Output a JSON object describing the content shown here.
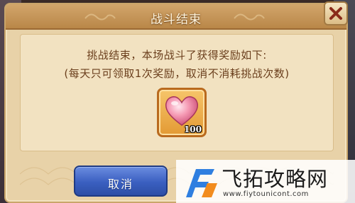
{
  "dialog": {
    "title": "战斗结束",
    "message_line1": "挑战结束，本场战斗了获得奖励如下:",
    "message_line2": "(每天只可领取1次奖励，取消不消耗挑战次数)",
    "reward": {
      "icon": "heart-icon",
      "count": "100"
    },
    "cancel_label": "取消"
  },
  "watermark": {
    "title": "飞拓攻略网",
    "url": "www.fiytounicont.com"
  },
  "colors": {
    "title_bar": "#c39456",
    "panel_bg": "#f2e2c1",
    "message_text": "#6b3f1d",
    "cancel_button": "#3a5fc0",
    "reward_slot": "#e9a648"
  }
}
